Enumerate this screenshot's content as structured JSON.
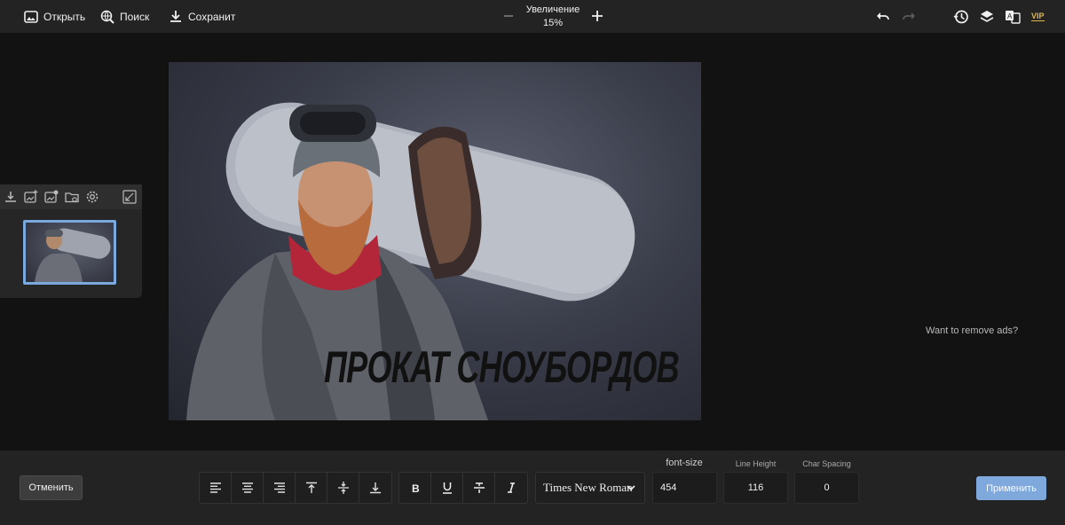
{
  "toolbar": {
    "open_label": "Открыть",
    "search_label": "Поиск",
    "save_label": "Сохранит",
    "zoom_label": "Увеличение",
    "zoom_value": "15%",
    "vip_label": "VIP"
  },
  "canvas": {
    "overlay_text": "ПРОКАТ СНОУБОРДОВ"
  },
  "ads": {
    "text": "Want to remove ads?"
  },
  "bottom": {
    "cancel_label": "Отменить",
    "apply_label": "Применить",
    "font_family": "Times New Roman",
    "font_size_label": "font-size",
    "font_size_value": "454",
    "line_height_label": "Line Height",
    "line_height_value": "116",
    "char_spacing_label": "Char Spacing",
    "char_spacing_value": "0"
  },
  "icons": {
    "left_panel": [
      "download-icon",
      "add-image-icon",
      "image-settings-icon",
      "folder-image-icon",
      "gear-icon",
      "collapse-icon"
    ],
    "align": [
      "align-left-icon",
      "align-center-icon",
      "align-right-icon",
      "align-top-icon",
      "align-middle-icon",
      "align-bottom-icon"
    ],
    "style": [
      "bold-icon",
      "underline-icon",
      "strikethrough-icon",
      "italic-icon"
    ]
  },
  "colors": {
    "accent": "#7fa8dc",
    "thumbnail_border": "#7aa9e0",
    "background": "#121212",
    "bar": "#232323"
  }
}
